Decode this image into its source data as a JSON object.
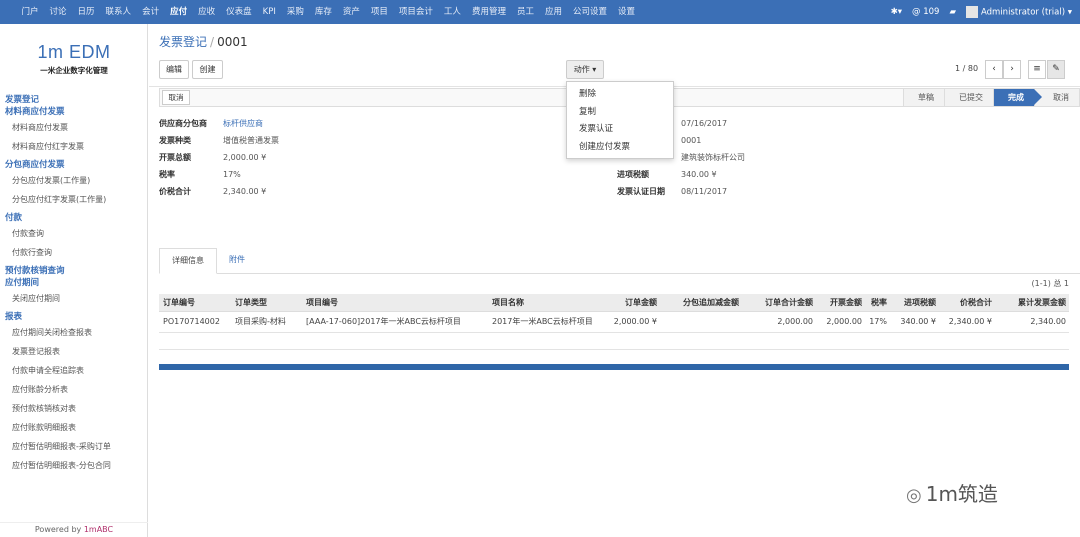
{
  "topnav": {
    "items": [
      "门户",
      "讨论",
      "日历",
      "联系人",
      "会计",
      "应付",
      "应收",
      "仪表盘",
      "KPI",
      "采购",
      "库存",
      "资产",
      "项目",
      "项目会计",
      "工人",
      "费用管理",
      "员工",
      "应用",
      "公司设置",
      "设置"
    ],
    "active": "应付",
    "notify_count": "@ 109",
    "user": "Administrator (trial)"
  },
  "logo": {
    "title": "1m EDM",
    "subtitle": "一米企业数字化管理"
  },
  "sidebar": {
    "sections": [
      {
        "title": "发票登记",
        "items": []
      },
      {
        "title": "材料商应付发票",
        "items": [
          "材料商应付发票",
          "材料商应付红字发票"
        ]
      },
      {
        "title": "分包商应付发票",
        "items": [
          "分包应付发票(工作量)",
          "分包应付红字发票(工作量)"
        ]
      },
      {
        "title": "付款",
        "items": [
          "付款查询",
          "付款行查询"
        ]
      },
      {
        "title": "预付款核销查询",
        "items": []
      },
      {
        "title": "应付期间",
        "items": [
          "关闭应付期间"
        ]
      },
      {
        "title": "报表",
        "items": [
          "应付期间关闭检查报表",
          "发票登记报表",
          "付款申请全程追踪表",
          "应付账龄分析表",
          "预付款核销核对表",
          "应付账款明细报表",
          "应付暂估明细报表-采购订单",
          "应付暂估明细报表-分包合同"
        ]
      }
    ],
    "powered_prefix": "Powered by ",
    "powered_brand": "1mABC"
  },
  "breadcrumb": {
    "parent": "发票登记",
    "current": "0001"
  },
  "toolbar": {
    "edit": "编辑",
    "create": "创建",
    "action": "动作 ▾"
  },
  "pager": {
    "text": "1 / 80"
  },
  "dropdown": {
    "items": [
      "删除",
      "复制",
      "发票认证",
      "创建应付发票"
    ]
  },
  "statusbar": {
    "cancel": "取消",
    "stages": [
      "草稿",
      "已提交",
      "完成",
      "取消"
    ],
    "current": "完成"
  },
  "form": {
    "left": [
      {
        "label": "供应商分包商",
        "value": "标杆供应商",
        "link": true
      },
      {
        "label": "发票种类",
        "value": "增值税普通发票"
      },
      {
        "label": "开票总额",
        "value": "2,000.00 ¥"
      },
      {
        "label": "税率",
        "value": "17%"
      },
      {
        "label": "价税合计",
        "value": "2,340.00 ¥"
      }
    ],
    "right": [
      {
        "label": "",
        "value": "07/16/2017"
      },
      {
        "label": "",
        "value": "0001"
      },
      {
        "label": "",
        "value": "建筑装饰标杆公司"
      },
      {
        "label": "进项税额",
        "value": "340.00 ¥"
      },
      {
        "label": "发票认证日期",
        "value": "08/11/2017"
      }
    ]
  },
  "tabs": [
    "详细信息",
    "附件"
  ],
  "record_count": "(1-1) 总 1",
  "table": {
    "headers": [
      "订单编号",
      "订单类型",
      "项目编号",
      "项目名称",
      "订单金额",
      "分包追加减金额",
      "订单合计金额",
      "开票金额",
      "税率",
      "进项税额",
      "价税合计",
      "累计发票金额"
    ],
    "rows": [
      [
        "PO170714002",
        "项目采购-材料",
        "[AAA-17-060]2017年一米ABC云标杆项目",
        "2017年一米ABC云标杆项目",
        "2,000.00 ¥",
        "",
        "2,000.00",
        "2,000.00",
        "17%",
        "340.00 ¥",
        "2,340.00 ¥",
        "2,340.00"
      ]
    ]
  },
  "watermark": "1m筑造"
}
